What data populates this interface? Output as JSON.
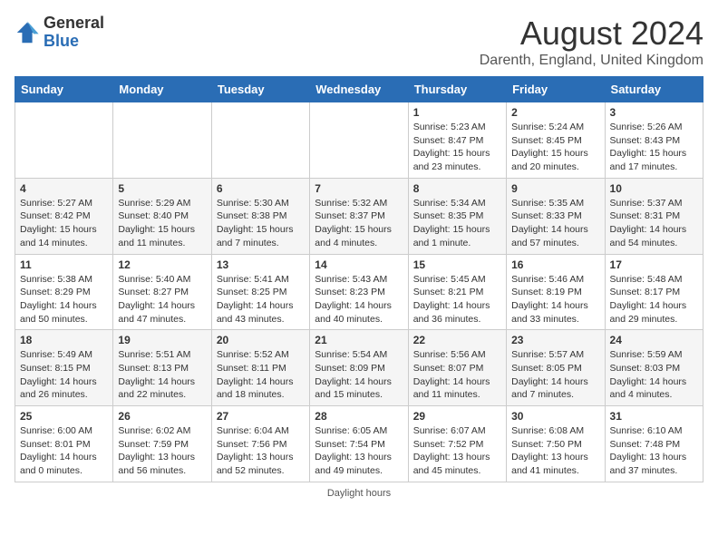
{
  "header": {
    "logo_general": "General",
    "logo_blue": "Blue",
    "month_year": "August 2024",
    "location": "Darenth, England, United Kingdom"
  },
  "days_of_week": [
    "Sunday",
    "Monday",
    "Tuesday",
    "Wednesday",
    "Thursday",
    "Friday",
    "Saturday"
  ],
  "weeks": [
    [
      {
        "day": "",
        "sunrise": "",
        "sunset": "",
        "daylight": ""
      },
      {
        "day": "",
        "sunrise": "",
        "sunset": "",
        "daylight": ""
      },
      {
        "day": "",
        "sunrise": "",
        "sunset": "",
        "daylight": ""
      },
      {
        "day": "",
        "sunrise": "",
        "sunset": "",
        "daylight": ""
      },
      {
        "day": "1",
        "sunrise": "Sunrise: 5:23 AM",
        "sunset": "Sunset: 8:47 PM",
        "daylight": "Daylight: 15 hours and 23 minutes."
      },
      {
        "day": "2",
        "sunrise": "Sunrise: 5:24 AM",
        "sunset": "Sunset: 8:45 PM",
        "daylight": "Daylight: 15 hours and 20 minutes."
      },
      {
        "day": "3",
        "sunrise": "Sunrise: 5:26 AM",
        "sunset": "Sunset: 8:43 PM",
        "daylight": "Daylight: 15 hours and 17 minutes."
      }
    ],
    [
      {
        "day": "4",
        "sunrise": "Sunrise: 5:27 AM",
        "sunset": "Sunset: 8:42 PM",
        "daylight": "Daylight: 15 hours and 14 minutes."
      },
      {
        "day": "5",
        "sunrise": "Sunrise: 5:29 AM",
        "sunset": "Sunset: 8:40 PM",
        "daylight": "Daylight: 15 hours and 11 minutes."
      },
      {
        "day": "6",
        "sunrise": "Sunrise: 5:30 AM",
        "sunset": "Sunset: 8:38 PM",
        "daylight": "Daylight: 15 hours and 7 minutes."
      },
      {
        "day": "7",
        "sunrise": "Sunrise: 5:32 AM",
        "sunset": "Sunset: 8:37 PM",
        "daylight": "Daylight: 15 hours and 4 minutes."
      },
      {
        "day": "8",
        "sunrise": "Sunrise: 5:34 AM",
        "sunset": "Sunset: 8:35 PM",
        "daylight": "Daylight: 15 hours and 1 minute."
      },
      {
        "day": "9",
        "sunrise": "Sunrise: 5:35 AM",
        "sunset": "Sunset: 8:33 PM",
        "daylight": "Daylight: 14 hours and 57 minutes."
      },
      {
        "day": "10",
        "sunrise": "Sunrise: 5:37 AM",
        "sunset": "Sunset: 8:31 PM",
        "daylight": "Daylight: 14 hours and 54 minutes."
      }
    ],
    [
      {
        "day": "11",
        "sunrise": "Sunrise: 5:38 AM",
        "sunset": "Sunset: 8:29 PM",
        "daylight": "Daylight: 14 hours and 50 minutes."
      },
      {
        "day": "12",
        "sunrise": "Sunrise: 5:40 AM",
        "sunset": "Sunset: 8:27 PM",
        "daylight": "Daylight: 14 hours and 47 minutes."
      },
      {
        "day": "13",
        "sunrise": "Sunrise: 5:41 AM",
        "sunset": "Sunset: 8:25 PM",
        "daylight": "Daylight: 14 hours and 43 minutes."
      },
      {
        "day": "14",
        "sunrise": "Sunrise: 5:43 AM",
        "sunset": "Sunset: 8:23 PM",
        "daylight": "Daylight: 14 hours and 40 minutes."
      },
      {
        "day": "15",
        "sunrise": "Sunrise: 5:45 AM",
        "sunset": "Sunset: 8:21 PM",
        "daylight": "Daylight: 14 hours and 36 minutes."
      },
      {
        "day": "16",
        "sunrise": "Sunrise: 5:46 AM",
        "sunset": "Sunset: 8:19 PM",
        "daylight": "Daylight: 14 hours and 33 minutes."
      },
      {
        "day": "17",
        "sunrise": "Sunrise: 5:48 AM",
        "sunset": "Sunset: 8:17 PM",
        "daylight": "Daylight: 14 hours and 29 minutes."
      }
    ],
    [
      {
        "day": "18",
        "sunrise": "Sunrise: 5:49 AM",
        "sunset": "Sunset: 8:15 PM",
        "daylight": "Daylight: 14 hours and 26 minutes."
      },
      {
        "day": "19",
        "sunrise": "Sunrise: 5:51 AM",
        "sunset": "Sunset: 8:13 PM",
        "daylight": "Daylight: 14 hours and 22 minutes."
      },
      {
        "day": "20",
        "sunrise": "Sunrise: 5:52 AM",
        "sunset": "Sunset: 8:11 PM",
        "daylight": "Daylight: 14 hours and 18 minutes."
      },
      {
        "day": "21",
        "sunrise": "Sunrise: 5:54 AM",
        "sunset": "Sunset: 8:09 PM",
        "daylight": "Daylight: 14 hours and 15 minutes."
      },
      {
        "day": "22",
        "sunrise": "Sunrise: 5:56 AM",
        "sunset": "Sunset: 8:07 PM",
        "daylight": "Daylight: 14 hours and 11 minutes."
      },
      {
        "day": "23",
        "sunrise": "Sunrise: 5:57 AM",
        "sunset": "Sunset: 8:05 PM",
        "daylight": "Daylight: 14 hours and 7 minutes."
      },
      {
        "day": "24",
        "sunrise": "Sunrise: 5:59 AM",
        "sunset": "Sunset: 8:03 PM",
        "daylight": "Daylight: 14 hours and 4 minutes."
      }
    ],
    [
      {
        "day": "25",
        "sunrise": "Sunrise: 6:00 AM",
        "sunset": "Sunset: 8:01 PM",
        "daylight": "Daylight: 14 hours and 0 minutes."
      },
      {
        "day": "26",
        "sunrise": "Sunrise: 6:02 AM",
        "sunset": "Sunset: 7:59 PM",
        "daylight": "Daylight: 13 hours and 56 minutes."
      },
      {
        "day": "27",
        "sunrise": "Sunrise: 6:04 AM",
        "sunset": "Sunset: 7:56 PM",
        "daylight": "Daylight: 13 hours and 52 minutes."
      },
      {
        "day": "28",
        "sunrise": "Sunrise: 6:05 AM",
        "sunset": "Sunset: 7:54 PM",
        "daylight": "Daylight: 13 hours and 49 minutes."
      },
      {
        "day": "29",
        "sunrise": "Sunrise: 6:07 AM",
        "sunset": "Sunset: 7:52 PM",
        "daylight": "Daylight: 13 hours and 45 minutes."
      },
      {
        "day": "30",
        "sunrise": "Sunrise: 6:08 AM",
        "sunset": "Sunset: 7:50 PM",
        "daylight": "Daylight: 13 hours and 41 minutes."
      },
      {
        "day": "31",
        "sunrise": "Sunrise: 6:10 AM",
        "sunset": "Sunset: 7:48 PM",
        "daylight": "Daylight: 13 hours and 37 minutes."
      }
    ]
  ],
  "footer": {
    "daylight_label": "Daylight hours"
  }
}
